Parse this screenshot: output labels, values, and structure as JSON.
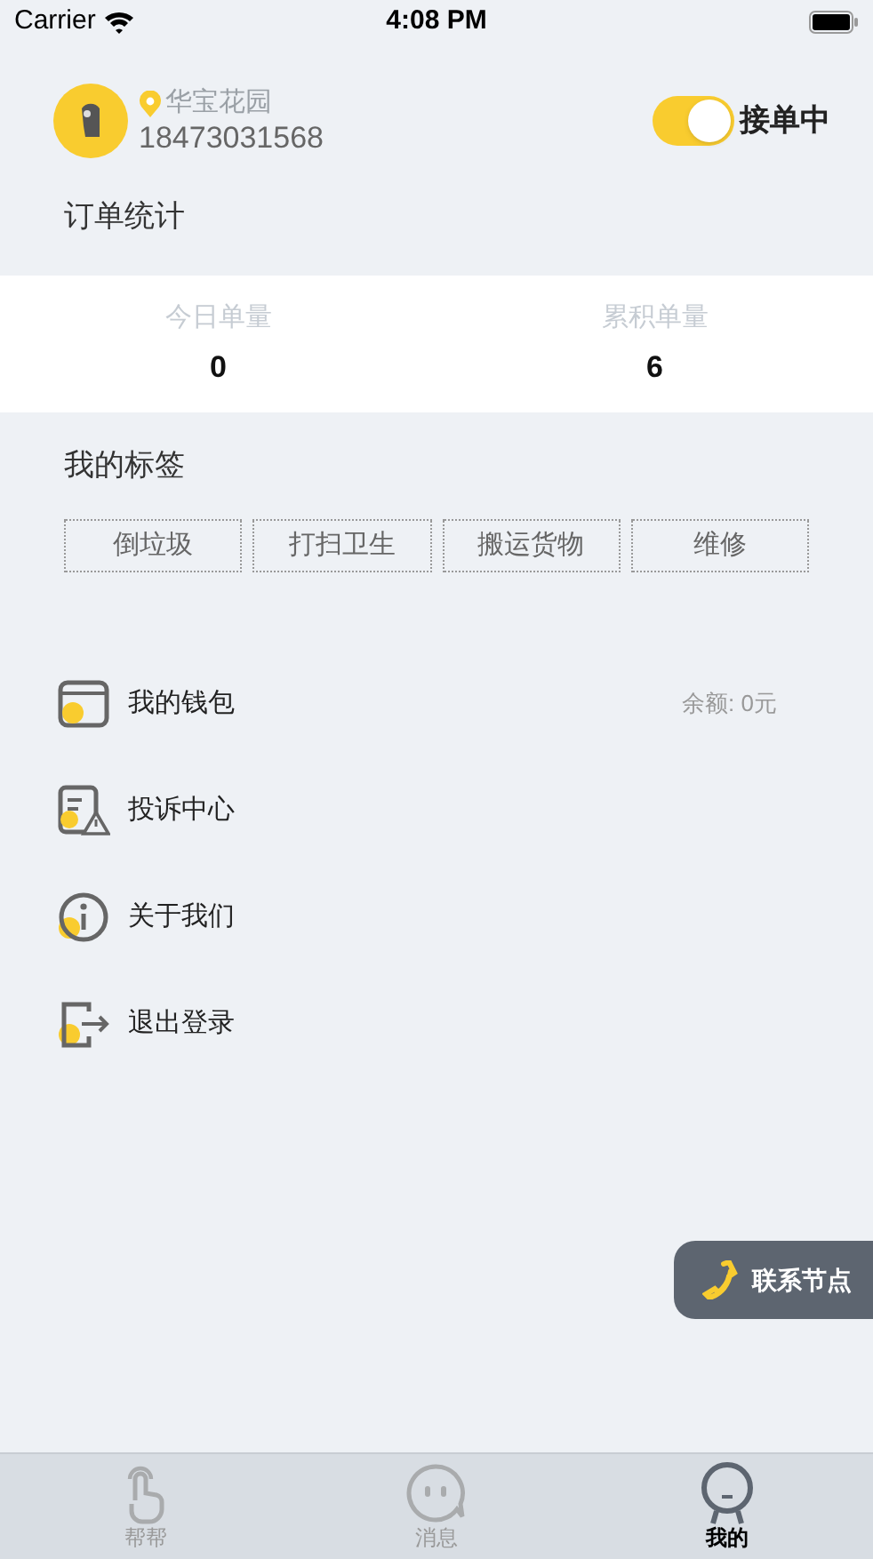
{
  "status_bar": {
    "carrier": "Carrier",
    "time": "4:08 PM"
  },
  "profile": {
    "location": "华宝花园",
    "phone": "18473031568",
    "accepting": {
      "on": true,
      "label": "接单中"
    }
  },
  "order_stats": {
    "title": "订单统计",
    "items": [
      {
        "label": "今日单量",
        "value": "0"
      },
      {
        "label": "累积单量",
        "value": "6"
      }
    ]
  },
  "tags": {
    "title": "我的标签",
    "items": [
      "倒垃圾",
      "打扫卫生",
      "搬运货物",
      "维修"
    ]
  },
  "menu": [
    {
      "kind": "wallet",
      "label": "我的钱包",
      "detail": "余额: 0元"
    },
    {
      "kind": "complaint",
      "label": "投诉中心"
    },
    {
      "kind": "about",
      "label": "关于我们"
    },
    {
      "kind": "logout",
      "label": "退出登录"
    }
  ],
  "contact_button": "联系节点",
  "tab_bar": [
    {
      "kind": "help",
      "label": "帮帮",
      "selected": false
    },
    {
      "kind": "messages",
      "label": "消息",
      "selected": false
    },
    {
      "kind": "me",
      "label": "我的",
      "selected": true
    }
  ]
}
